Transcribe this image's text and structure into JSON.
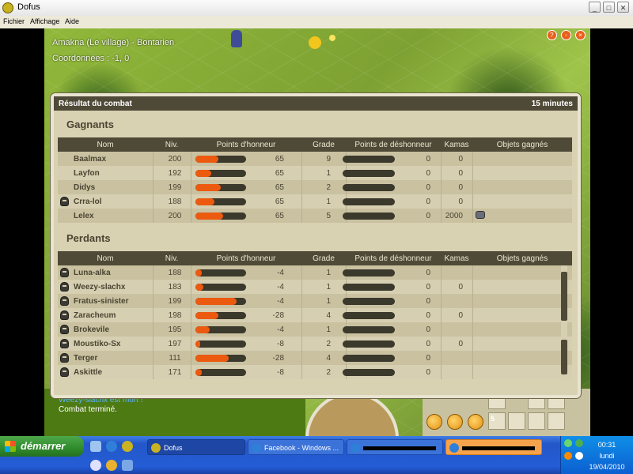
{
  "window": {
    "title": "Dofus",
    "menu": [
      "Fichier",
      "Affichage",
      "Aide"
    ],
    "controls": [
      "_",
      "□",
      "✕"
    ]
  },
  "game": {
    "map_name": "Amakna (Le village) - Bontarien",
    "coordinates": "Coordonnées : -1, 0",
    "chat": [
      "Weezy-slachx est mort !",
      "Combat terminé."
    ],
    "inventory_count": "5"
  },
  "combat": {
    "title": "Résultat du combat",
    "duration": "15 minutes",
    "winners_title": "Gagnants",
    "losers_title": "Perdants",
    "columns": [
      "Nom",
      "Niv.",
      "Points d'honneur",
      "Grade",
      "Points de déshonneur",
      "Kamas",
      "Objets gagnés"
    ],
    "winners": [
      {
        "name": "Baalmax",
        "level": "200",
        "honour": "65",
        "honour_fill": 0.45,
        "grade": "9",
        "dishonour": "0",
        "kamas": "0",
        "dead": false,
        "item": false
      },
      {
        "name": "Layfon",
        "level": "192",
        "honour": "65",
        "honour_fill": 0.32,
        "grade": "1",
        "dishonour": "0",
        "kamas": "0",
        "dead": false,
        "item": false
      },
      {
        "name": "Didys",
        "level": "199",
        "honour": "65",
        "honour_fill": 0.5,
        "grade": "2",
        "dishonour": "0",
        "kamas": "0",
        "dead": false,
        "item": false
      },
      {
        "name": "Crra-lol",
        "level": "188",
        "honour": "65",
        "honour_fill": 0.38,
        "grade": "1",
        "dishonour": "0",
        "kamas": "0",
        "dead": true,
        "item": false
      },
      {
        "name": "Lelex",
        "level": "200",
        "honour": "65",
        "honour_fill": 0.55,
        "grade": "5",
        "dishonour": "0",
        "kamas": "2000",
        "dead": false,
        "item": true
      }
    ],
    "losers": [
      {
        "name": "Luna-alka",
        "level": "188",
        "honour": "-4",
        "honour_fill": 0.12,
        "grade": "1",
        "dishonour": "0",
        "kamas": "",
        "dead": true
      },
      {
        "name": "Weezy-slachx",
        "level": "183",
        "honour": "-4",
        "honour_fill": 0.15,
        "grade": "1",
        "dishonour": "0",
        "kamas": "0",
        "dead": true
      },
      {
        "name": "Fratus-sinister",
        "level": "199",
        "honour": "-4",
        "honour_fill": 0.82,
        "grade": "1",
        "dishonour": "0",
        "kamas": "",
        "dead": true
      },
      {
        "name": "Zaracheum",
        "level": "198",
        "honour": "-28",
        "honour_fill": 0.45,
        "grade": "4",
        "dishonour": "0",
        "kamas": "0",
        "dead": true
      },
      {
        "name": "Brokevile",
        "level": "195",
        "honour": "-4",
        "honour_fill": 0.28,
        "grade": "1",
        "dishonour": "0",
        "kamas": "",
        "dead": true
      },
      {
        "name": "Moustiko-Sx",
        "level": "197",
        "honour": "-8",
        "honour_fill": 0.1,
        "grade": "2",
        "dishonour": "0",
        "kamas": "0",
        "dead": true
      },
      {
        "name": "Terger",
        "level": "111",
        "honour": "-28",
        "honour_fill": 0.65,
        "grade": "4",
        "dishonour": "0",
        "kamas": "",
        "dead": true
      },
      {
        "name": "Askittle",
        "level": "171",
        "honour": "-8",
        "honour_fill": 0.12,
        "grade": "2",
        "dishonour": "0",
        "kamas": "",
        "dead": true
      }
    ]
  },
  "taskbar": {
    "start_label": "démarrer",
    "tasks": [
      "Dofus",
      "Facebook - Windows ...",
      "",
      ""
    ],
    "time": "00:31",
    "day": "lundi",
    "date": "19/04/2010"
  },
  "colors": {
    "honour_fill": "#ec5a10",
    "header_bg": "#4f4a37",
    "taskbar_blue": "#245dd6"
  }
}
